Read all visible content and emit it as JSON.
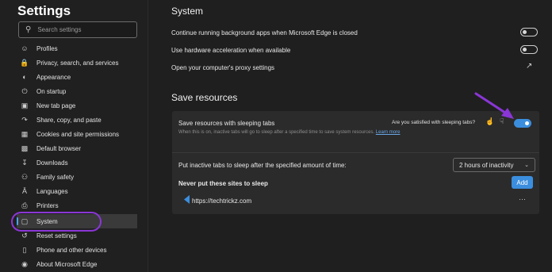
{
  "sidebar": {
    "title": "Settings",
    "search_placeholder": "Search settings",
    "items": [
      {
        "label": "Profiles",
        "icon": "person-icon"
      },
      {
        "label": "Privacy, search, and services",
        "icon": "lock-icon"
      },
      {
        "label": "Appearance",
        "icon": "palette-icon"
      },
      {
        "label": "On startup",
        "icon": "power-icon"
      },
      {
        "label": "New tab page",
        "icon": "new-tab-icon"
      },
      {
        "label": "Share, copy, and paste",
        "icon": "share-icon"
      },
      {
        "label": "Cookies and site permissions",
        "icon": "cookie-icon"
      },
      {
        "label": "Default browser",
        "icon": "browser-icon"
      },
      {
        "label": "Downloads",
        "icon": "download-icon"
      },
      {
        "label": "Family safety",
        "icon": "family-icon"
      },
      {
        "label": "Languages",
        "icon": "language-icon"
      },
      {
        "label": "Printers",
        "icon": "printer-icon"
      },
      {
        "label": "System",
        "icon": "laptop-icon",
        "selected": true
      },
      {
        "label": "Reset settings",
        "icon": "reset-icon"
      },
      {
        "label": "Phone and other devices",
        "icon": "phone-icon"
      },
      {
        "label": "About Microsoft Edge",
        "icon": "edge-icon"
      }
    ]
  },
  "main": {
    "system_heading": "System",
    "system_rows": [
      {
        "label": "Continue running background apps when Microsoft Edge is closed",
        "control": "toggle",
        "on": false
      },
      {
        "label": "Use hardware acceleration when available",
        "control": "toggle",
        "on": false
      },
      {
        "label": "Open your computer's proxy settings",
        "control": "external-link-icon"
      }
    ],
    "save_heading": "Save resources",
    "sleeping_tabs": {
      "label": "Save resources with sleeping tabs",
      "feedback_prompt": "Are you satisfied with sleeping tabs?",
      "on": true,
      "description": "When this is on, inactive tabs will go to sleep after a specified time to save system resources.",
      "learn_more": "Learn more"
    },
    "sleep_after": {
      "label": "Put inactive tabs to sleep after the specified amount of time:",
      "selected": "2 hours of inactivity"
    },
    "never_sleep": {
      "label": "Never put these sites to sleep",
      "add_label": "Add",
      "sites": [
        {
          "url": "https://techtrickz.com",
          "menu": "···"
        }
      ]
    }
  },
  "colors": {
    "accent": "#3b8ede",
    "annotation": "#8a36d6"
  }
}
